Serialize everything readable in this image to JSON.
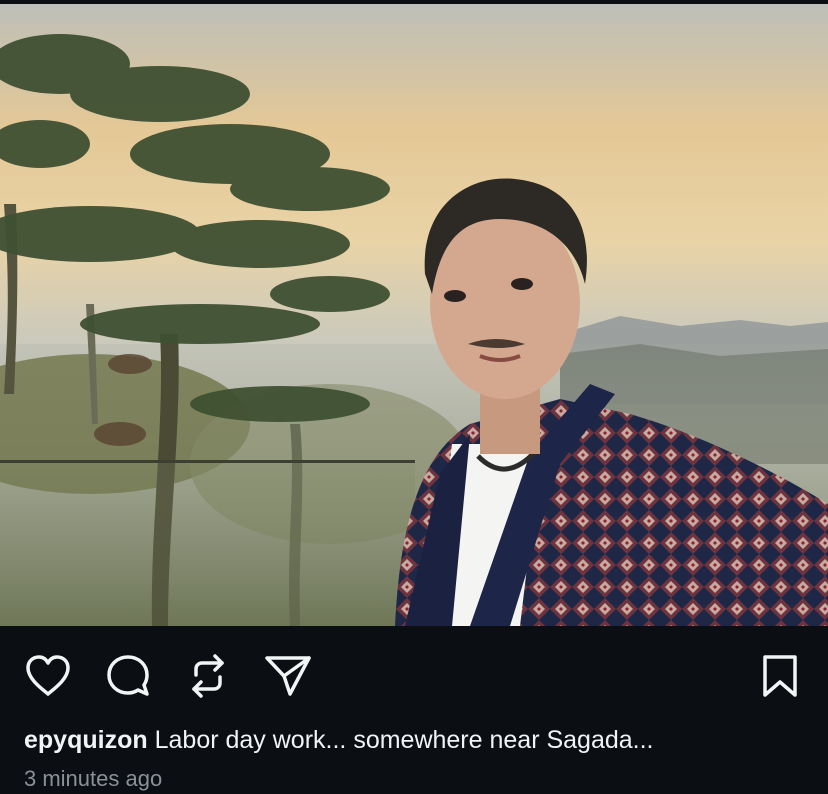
{
  "post": {
    "username": "epyquizon",
    "caption": "Labor day work... somewhere near Sagada...",
    "timestamp": "3 minutes ago",
    "image_alt": "Selfie of a man in an embroidered jacket in front of misty pine trees and mountains"
  },
  "actions": {
    "like_icon": "heart-icon",
    "comment_icon": "comment-icon",
    "repost_icon": "repost-icon",
    "share_icon": "send-icon",
    "save_icon": "bookmark-icon"
  },
  "colors": {
    "background": "#0b0f14",
    "text": "#f1f3f5",
    "muted": "#8a9096"
  }
}
